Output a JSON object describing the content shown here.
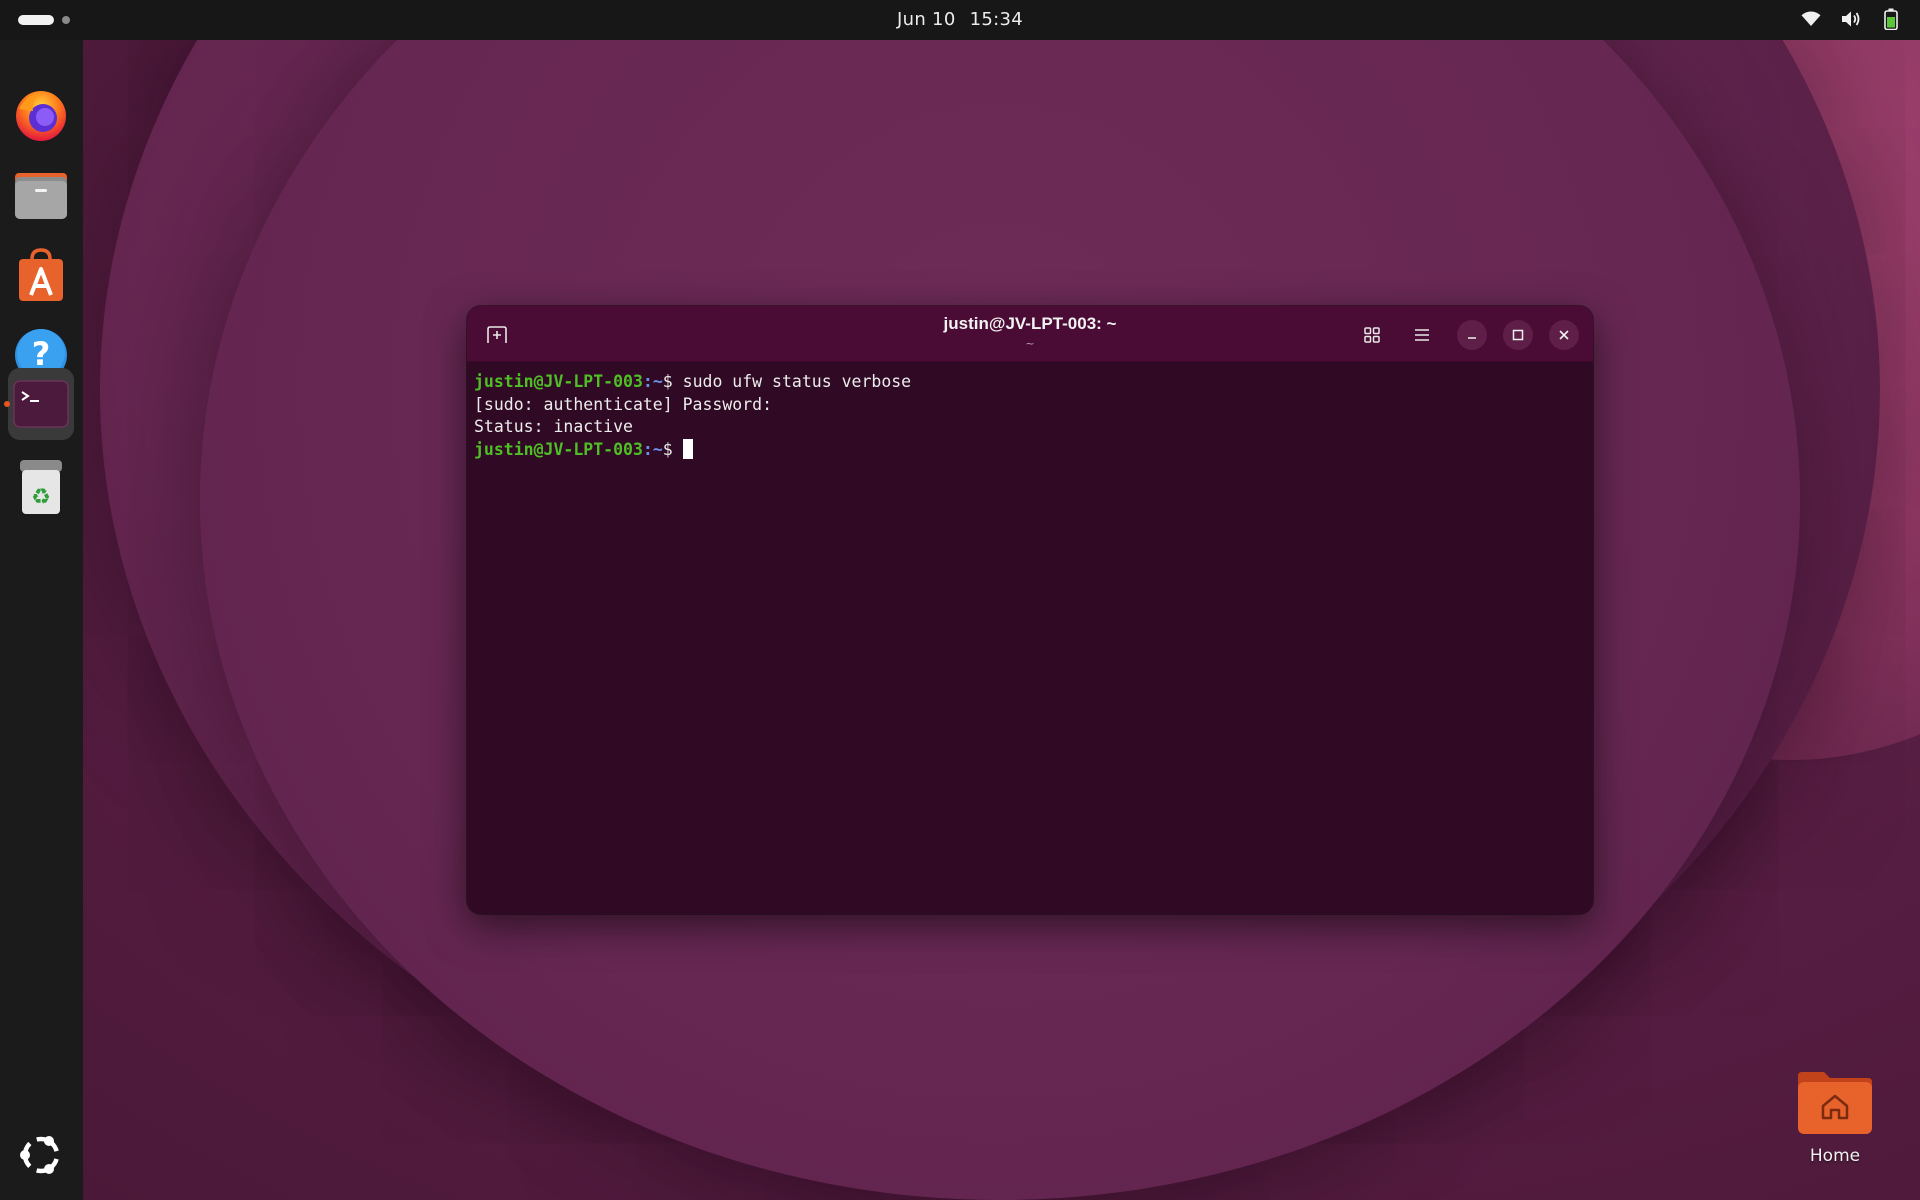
{
  "topbar": {
    "date": "Jun 10",
    "time": "15:34"
  },
  "dock": {
    "items": [
      {
        "name": "Firefox",
        "icon": "firefox-icon"
      },
      {
        "name": "Files",
        "icon": "files-icon"
      },
      {
        "name": "App Center",
        "icon": "app-center-icon"
      },
      {
        "name": "Help",
        "icon": "help-icon"
      },
      {
        "name": "Terminal",
        "icon": "terminal-icon",
        "active": true
      },
      {
        "name": "Trash",
        "icon": "trash-icon"
      }
    ]
  },
  "terminal": {
    "title": "justin@JV-LPT-003: ~",
    "subtitle": "~",
    "prompt_user": "justin@JV-LPT-003",
    "prompt_path": ":~",
    "prompt_symbol": "$ ",
    "command": "sudo ufw status verbose",
    "output": [
      "[sudo: authenticate] Password:",
      "Status: inactive"
    ]
  },
  "desktop": {
    "home_label": "Home"
  },
  "colors": {
    "prompt_user": "#4fbf26",
    "prompt_path": "#6f8fe6",
    "terminal_bg": "#300a24",
    "header_bg": "#4a0c34",
    "accent": "#e95420"
  }
}
